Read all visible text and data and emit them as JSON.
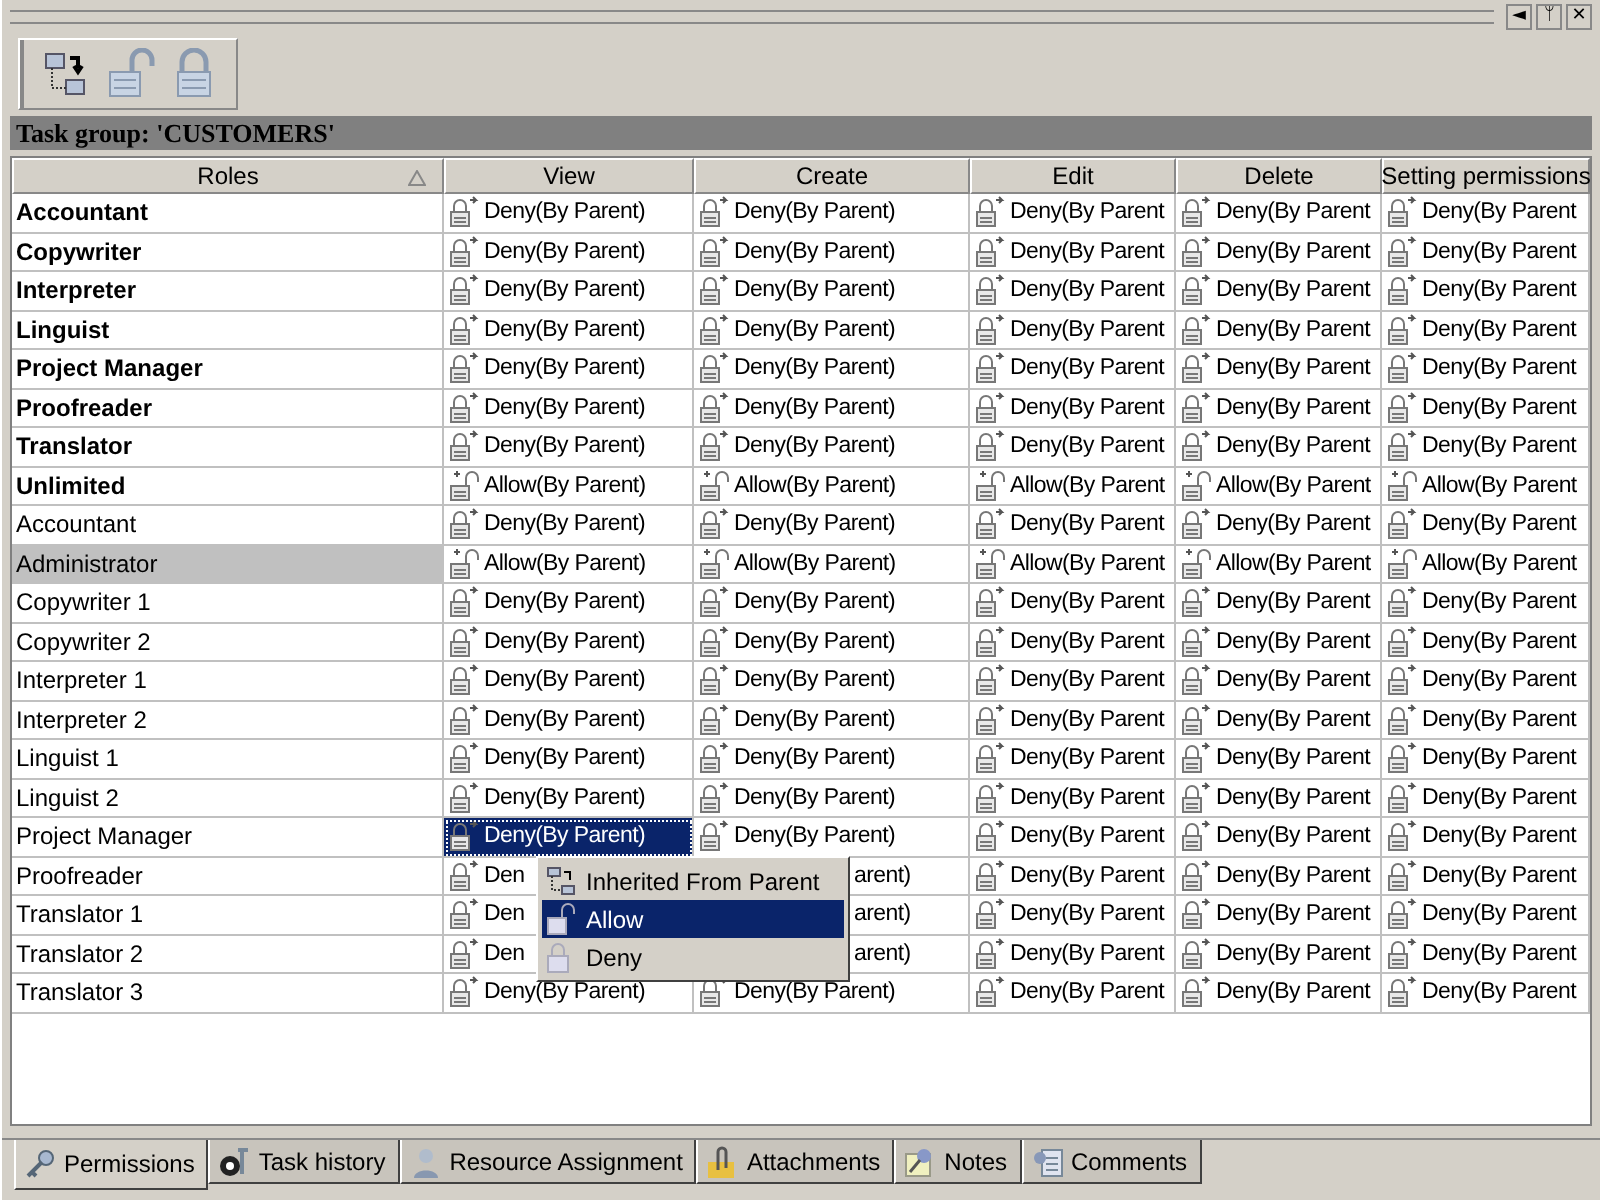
{
  "window_buttons": [
    "◄",
    "ᛘ",
    "✕"
  ],
  "toolbar": [
    {
      "kind": "inherit"
    },
    {
      "kind": "allow"
    },
    {
      "kind": "deny"
    }
  ],
  "group_header": "Task group: 'CUSTOMERS'",
  "columns": [
    {
      "label": "Roles",
      "sorted": true
    },
    {
      "label": "View",
      "sorted": false
    },
    {
      "label": "Create",
      "sorted": false
    },
    {
      "label": "Edit",
      "sorted": false
    },
    {
      "label": "Delete",
      "sorted": false
    },
    {
      "label": "Setting permissions",
      "sorted": false
    }
  ],
  "rows": [
    {
      "role": "Accountant",
      "kind": "group",
      "selected": false,
      "cells": [
        {
          "text": "Deny(By Parent)",
          "kind": "deny",
          "selected": false
        },
        {
          "text": "Deny(By Parent)",
          "kind": "deny",
          "selected": false
        },
        {
          "text": "Deny(By Parent",
          "kind": "deny",
          "selected": false
        },
        {
          "text": "Deny(By Parent",
          "kind": "deny",
          "selected": false
        },
        {
          "text": "Deny(By Parent",
          "kind": "deny",
          "selected": false
        }
      ]
    },
    {
      "role": "Copywriter",
      "kind": "group",
      "selected": false,
      "cells": [
        {
          "text": "Deny(By Parent)",
          "kind": "deny",
          "selected": false
        },
        {
          "text": "Deny(By Parent)",
          "kind": "deny",
          "selected": false
        },
        {
          "text": "Deny(By Parent",
          "kind": "deny",
          "selected": false
        },
        {
          "text": "Deny(By Parent",
          "kind": "deny",
          "selected": false
        },
        {
          "text": "Deny(By Parent",
          "kind": "deny",
          "selected": false
        }
      ]
    },
    {
      "role": "Interpreter",
      "kind": "group",
      "selected": false,
      "cells": [
        {
          "text": "Deny(By Parent)",
          "kind": "deny",
          "selected": false
        },
        {
          "text": "Deny(By Parent)",
          "kind": "deny",
          "selected": false
        },
        {
          "text": "Deny(By Parent",
          "kind": "deny",
          "selected": false
        },
        {
          "text": "Deny(By Parent",
          "kind": "deny",
          "selected": false
        },
        {
          "text": "Deny(By Parent",
          "kind": "deny",
          "selected": false
        }
      ]
    },
    {
      "role": "Linguist",
      "kind": "group",
      "selected": false,
      "cells": [
        {
          "text": "Deny(By Parent)",
          "kind": "deny",
          "selected": false
        },
        {
          "text": "Deny(By Parent)",
          "kind": "deny",
          "selected": false
        },
        {
          "text": "Deny(By Parent",
          "kind": "deny",
          "selected": false
        },
        {
          "text": "Deny(By Parent",
          "kind": "deny",
          "selected": false
        },
        {
          "text": "Deny(By Parent",
          "kind": "deny",
          "selected": false
        }
      ]
    },
    {
      "role": "Project Manager",
      "kind": "group",
      "selected": false,
      "cells": [
        {
          "text": "Deny(By Parent)",
          "kind": "deny",
          "selected": false
        },
        {
          "text": "Deny(By Parent)",
          "kind": "deny",
          "selected": false
        },
        {
          "text": "Deny(By Parent",
          "kind": "deny",
          "selected": false
        },
        {
          "text": "Deny(By Parent",
          "kind": "deny",
          "selected": false
        },
        {
          "text": "Deny(By Parent",
          "kind": "deny",
          "selected": false
        }
      ]
    },
    {
      "role": "Proofreader",
      "kind": "group",
      "selected": false,
      "cells": [
        {
          "text": "Deny(By Parent)",
          "kind": "deny",
          "selected": false
        },
        {
          "text": "Deny(By Parent)",
          "kind": "deny",
          "selected": false
        },
        {
          "text": "Deny(By Parent",
          "kind": "deny",
          "selected": false
        },
        {
          "text": "Deny(By Parent",
          "kind": "deny",
          "selected": false
        },
        {
          "text": "Deny(By Parent",
          "kind": "deny",
          "selected": false
        }
      ]
    },
    {
      "role": "Translator",
      "kind": "group",
      "selected": false,
      "cells": [
        {
          "text": "Deny(By Parent)",
          "kind": "deny",
          "selected": false
        },
        {
          "text": "Deny(By Parent)",
          "kind": "deny",
          "selected": false
        },
        {
          "text": "Deny(By Parent",
          "kind": "deny",
          "selected": false
        },
        {
          "text": "Deny(By Parent",
          "kind": "deny",
          "selected": false
        },
        {
          "text": "Deny(By Parent",
          "kind": "deny",
          "selected": false
        }
      ]
    },
    {
      "role": "Unlimited",
      "kind": "group",
      "selected": false,
      "cells": [
        {
          "text": "Allow(By Parent)",
          "kind": "allow",
          "selected": false
        },
        {
          "text": "Allow(By Parent)",
          "kind": "allow",
          "selected": false
        },
        {
          "text": "Allow(By Parent",
          "kind": "allow",
          "selected": false
        },
        {
          "text": "Allow(By Parent",
          "kind": "allow",
          "selected": false
        },
        {
          "text": "Allow(By Parent",
          "kind": "allow",
          "selected": false
        }
      ]
    },
    {
      "role": "Accountant",
      "kind": "user",
      "selected": false,
      "cells": [
        {
          "text": "Deny(By Parent)",
          "kind": "deny",
          "selected": false
        },
        {
          "text": "Deny(By Parent)",
          "kind": "deny",
          "selected": false
        },
        {
          "text": "Deny(By Parent",
          "kind": "deny",
          "selected": false
        },
        {
          "text": "Deny(By Parent",
          "kind": "deny",
          "selected": false
        },
        {
          "text": "Deny(By Parent",
          "kind": "deny",
          "selected": false
        }
      ]
    },
    {
      "role": "Administrator",
      "kind": "user",
      "selected": true,
      "cells": [
        {
          "text": "Allow(By Parent)",
          "kind": "allow",
          "selected": false
        },
        {
          "text": "Allow(By Parent)",
          "kind": "allow",
          "selected": false
        },
        {
          "text": "Allow(By Parent",
          "kind": "allow",
          "selected": false
        },
        {
          "text": "Allow(By Parent",
          "kind": "allow",
          "selected": false
        },
        {
          "text": "Allow(By Parent",
          "kind": "allow",
          "selected": false
        }
      ]
    },
    {
      "role": "Copywriter 1",
      "kind": "user",
      "selected": false,
      "cells": [
        {
          "text": "Deny(By Parent)",
          "kind": "deny",
          "selected": false
        },
        {
          "text": "Deny(By Parent)",
          "kind": "deny",
          "selected": false
        },
        {
          "text": "Deny(By Parent",
          "kind": "deny",
          "selected": false
        },
        {
          "text": "Deny(By Parent",
          "kind": "deny",
          "selected": false
        },
        {
          "text": "Deny(By Parent",
          "kind": "deny",
          "selected": false
        }
      ]
    },
    {
      "role": "Copywriter 2",
      "kind": "user",
      "selected": false,
      "cells": [
        {
          "text": "Deny(By Parent)",
          "kind": "deny",
          "selected": false
        },
        {
          "text": "Deny(By Parent)",
          "kind": "deny",
          "selected": false
        },
        {
          "text": "Deny(By Parent",
          "kind": "deny",
          "selected": false
        },
        {
          "text": "Deny(By Parent",
          "kind": "deny",
          "selected": false
        },
        {
          "text": "Deny(By Parent",
          "kind": "deny",
          "selected": false
        }
      ]
    },
    {
      "role": "Interpreter 1",
      "kind": "user",
      "selected": false,
      "cells": [
        {
          "text": "Deny(By Parent)",
          "kind": "deny",
          "selected": false
        },
        {
          "text": "Deny(By Parent)",
          "kind": "deny",
          "selected": false
        },
        {
          "text": "Deny(By Parent",
          "kind": "deny",
          "selected": false
        },
        {
          "text": "Deny(By Parent",
          "kind": "deny",
          "selected": false
        },
        {
          "text": "Deny(By Parent",
          "kind": "deny",
          "selected": false
        }
      ]
    },
    {
      "role": "Interpreter 2",
      "kind": "user",
      "selected": false,
      "cells": [
        {
          "text": "Deny(By Parent)",
          "kind": "deny",
          "selected": false
        },
        {
          "text": "Deny(By Parent)",
          "kind": "deny",
          "selected": false
        },
        {
          "text": "Deny(By Parent",
          "kind": "deny",
          "selected": false
        },
        {
          "text": "Deny(By Parent",
          "kind": "deny",
          "selected": false
        },
        {
          "text": "Deny(By Parent",
          "kind": "deny",
          "selected": false
        }
      ]
    },
    {
      "role": "Linguist 1",
      "kind": "user",
      "selected": false,
      "cells": [
        {
          "text": "Deny(By Parent)",
          "kind": "deny",
          "selected": false
        },
        {
          "text": "Deny(By Parent)",
          "kind": "deny",
          "selected": false
        },
        {
          "text": "Deny(By Parent",
          "kind": "deny",
          "selected": false
        },
        {
          "text": "Deny(By Parent",
          "kind": "deny",
          "selected": false
        },
        {
          "text": "Deny(By Parent",
          "kind": "deny",
          "selected": false
        }
      ]
    },
    {
      "role": "Linguist 2",
      "kind": "user",
      "selected": false,
      "cells": [
        {
          "text": "Deny(By Parent)",
          "kind": "deny",
          "selected": false
        },
        {
          "text": "Deny(By Parent)",
          "kind": "deny",
          "selected": false
        },
        {
          "text": "Deny(By Parent",
          "kind": "deny",
          "selected": false
        },
        {
          "text": "Deny(By Parent",
          "kind": "deny",
          "selected": false
        },
        {
          "text": "Deny(By Parent",
          "kind": "deny",
          "selected": false
        }
      ]
    },
    {
      "role": "Project Manager",
      "kind": "user",
      "selected": false,
      "cells": [
        {
          "text": "Deny(By Parent)",
          "kind": "deny",
          "selected": true
        },
        {
          "text": "Deny(By Parent)",
          "kind": "deny",
          "selected": false
        },
        {
          "text": "Deny(By Parent",
          "kind": "deny",
          "selected": false
        },
        {
          "text": "Deny(By Parent",
          "kind": "deny",
          "selected": false
        },
        {
          "text": "Deny(By Parent",
          "kind": "deny",
          "selected": false
        }
      ]
    },
    {
      "role": "Proofreader",
      "kind": "user",
      "selected": false,
      "cells": [
        {
          "text": "Den",
          "kind": "deny",
          "selected": false
        },
        {
          "text": "arent)",
          "kind": "covered",
          "selected": false
        },
        {
          "text": "Deny(By Parent",
          "kind": "deny",
          "selected": false
        },
        {
          "text": "Deny(By Parent",
          "kind": "deny",
          "selected": false
        },
        {
          "text": "Deny(By Parent",
          "kind": "deny",
          "selected": false
        }
      ]
    },
    {
      "role": "Translator 1",
      "kind": "user",
      "selected": false,
      "cells": [
        {
          "text": "Den",
          "kind": "deny",
          "selected": false
        },
        {
          "text": "arent)",
          "kind": "covered",
          "selected": false
        },
        {
          "text": "Deny(By Parent",
          "kind": "deny",
          "selected": false
        },
        {
          "text": "Deny(By Parent",
          "kind": "deny",
          "selected": false
        },
        {
          "text": "Deny(By Parent",
          "kind": "deny",
          "selected": false
        }
      ]
    },
    {
      "role": "Translator 2",
      "kind": "user",
      "selected": false,
      "cells": [
        {
          "text": "Den",
          "kind": "deny",
          "selected": false
        },
        {
          "text": "arent)",
          "kind": "covered",
          "selected": false
        },
        {
          "text": "Deny(By Parent",
          "kind": "deny",
          "selected": false
        },
        {
          "text": "Deny(By Parent",
          "kind": "deny",
          "selected": false
        },
        {
          "text": "Deny(By Parent",
          "kind": "deny",
          "selected": false
        }
      ]
    },
    {
      "role": "Translator 3",
      "kind": "user",
      "selected": false,
      "cells": [
        {
          "text": "Deny(By Parent)",
          "kind": "deny",
          "selected": false
        },
        {
          "text": "Deny(By Parent)",
          "kind": "deny",
          "selected": false
        },
        {
          "text": "Deny(By Parent",
          "kind": "deny",
          "selected": false
        },
        {
          "text": "Deny(By Parent",
          "kind": "deny",
          "selected": false
        },
        {
          "text": "Deny(By Parent",
          "kind": "deny",
          "selected": false
        }
      ]
    }
  ],
  "context_menu": [
    {
      "label": "Inherited From Parent",
      "kind": "inherit",
      "selected": false
    },
    {
      "label": "Allow",
      "kind": "allow",
      "selected": true
    },
    {
      "label": "Deny",
      "kind": "deny",
      "selected": false
    }
  ],
  "tabs": [
    {
      "label": "Permissions",
      "kind": "key",
      "selected": true
    },
    {
      "label": "Task history",
      "kind": "history",
      "selected": false
    },
    {
      "label": "Resource Assignment",
      "kind": "person",
      "selected": false
    },
    {
      "label": "Attachments",
      "kind": "clip",
      "selected": false
    },
    {
      "label": "Notes",
      "kind": "pin",
      "selected": false
    },
    {
      "label": "Comments",
      "kind": "comment",
      "selected": false
    }
  ]
}
